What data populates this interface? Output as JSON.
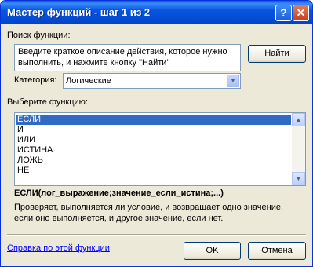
{
  "window": {
    "title": "Мастер функций - шаг 1 из 2",
    "help_label": "?",
    "close_label": "✕"
  },
  "search": {
    "label": "Поиск функции:",
    "value": "Введите краткое описание действия, которое нужно выполнить, и нажмите кнопку \"Найти\"",
    "find_button": "Найти"
  },
  "category": {
    "label": "Категория:",
    "selected": "Логические"
  },
  "functions": {
    "label": "Выберите функцию:",
    "items": [
      "ЕСЛИ",
      "И",
      "ИЛИ",
      "ИСТИНА",
      "ЛОЖЬ",
      "НЕ"
    ],
    "selected_index": 0
  },
  "selected_function": {
    "signature": "ЕСЛИ(лог_выражение;значение_если_истина;...)",
    "description": "Проверяет, выполняется ли условие, и возвращает одно значение, если оно выполняется, и другое значение, если нет."
  },
  "footer": {
    "help_link": "Справка по этой функции",
    "ok": "OK",
    "cancel": "Отмена"
  },
  "colors": {
    "titlebar": "#0054e3",
    "selection": "#316ac5",
    "link": "#0000ff"
  }
}
